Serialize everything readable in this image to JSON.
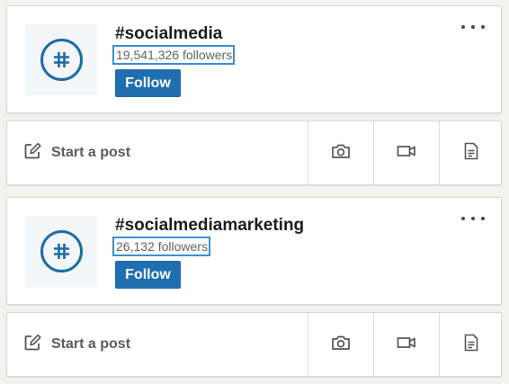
{
  "colors": {
    "accent": "#1f6fb0",
    "highlight_box": "#3b8ed4",
    "hash_icon": "#1a6ca8"
  },
  "hashtags": [
    {
      "title": "#socialmedia",
      "followers": "19,541,326 followers",
      "follow_label": "Follow",
      "icon": "hashtag-icon",
      "more_icon": "more-options-icon"
    },
    {
      "title": "#socialmediamarketing",
      "followers": "26,132 followers",
      "follow_label": "Follow",
      "icon": "hashtag-icon",
      "more_icon": "more-options-icon"
    }
  ],
  "post_bar": {
    "start_label": "Start a post",
    "start_icon": "edit-icon",
    "actions": [
      "camera-icon",
      "video-icon",
      "document-icon"
    ]
  }
}
